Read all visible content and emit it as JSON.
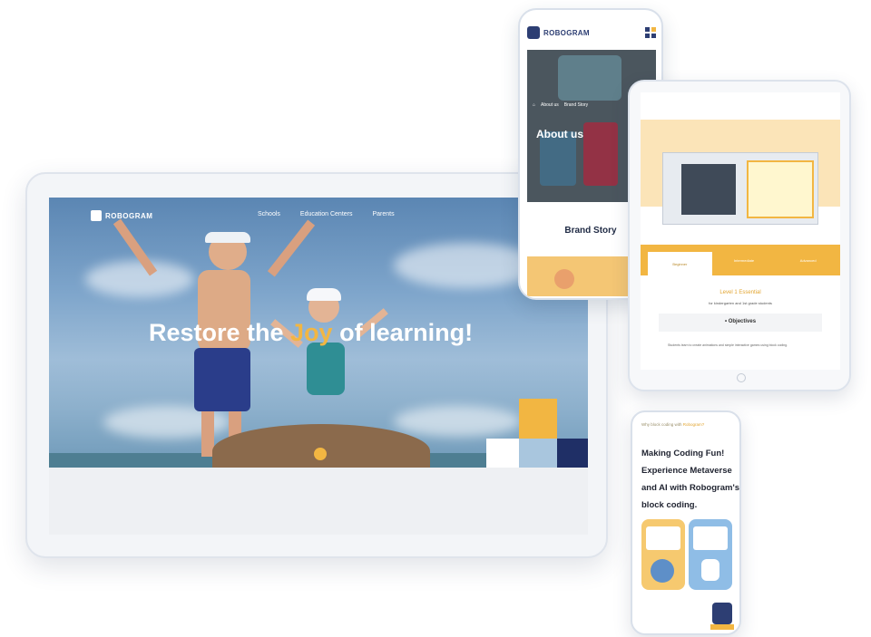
{
  "desktop": {
    "brand": "ROBOGRAM",
    "nav": [
      "Schools",
      "Education Centers",
      "Parents"
    ],
    "hero_title_before": "Restore the ",
    "hero_title_highlight": "Joy",
    "hero_title_after": " of learning!"
  },
  "phone_top": {
    "brand": "ROBOGRAM",
    "breadcrumb": [
      "About us",
      "Brand Story"
    ],
    "page_title": "About us",
    "section_title": "Brand Story"
  },
  "tablet": {
    "tabs": [
      "Beginner",
      "Intermediate",
      "Advanced"
    ],
    "level_label": "Level 1 Essential",
    "level_sub": "for kindergarten and 1st grade students",
    "objectives_title": "• Objectives",
    "objectives_text": "Students learn to create animations and simple interactive games using block coding."
  },
  "phone_bottom": {
    "eyebrow_before": "Why block coding with ",
    "eyebrow_highlight": "Robogram?",
    "headline": "Making Coding Fun! Experience Metaverse and AI with Robogram's block coding."
  },
  "colors": {
    "accent": "#f2b642",
    "navy": "#2d3e73",
    "text_dark": "#1f2330"
  }
}
